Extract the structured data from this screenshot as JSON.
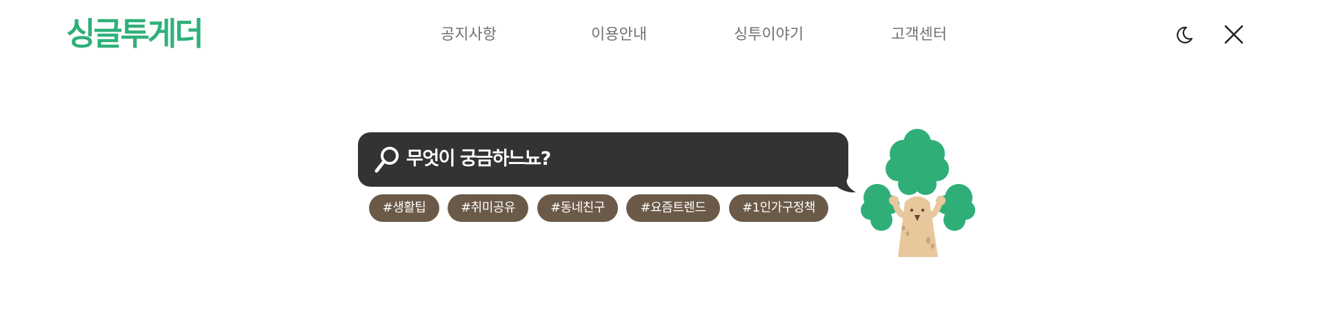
{
  "header": {
    "logo": "싱글투게더",
    "nav": [
      "공지사항",
      "이용안내",
      "싱투이야기",
      "고객센터"
    ],
    "icons": {
      "theme_toggle": "moon-icon",
      "close": "close-icon"
    }
  },
  "search": {
    "prompt": "무엇이 궁금하느뇨?",
    "icon": "search-icon",
    "tags": [
      "#생활팁",
      "#취미공유",
      "#동네친구",
      "#요즘트렌드",
      "#1인가구정책"
    ]
  },
  "colors": {
    "brand": "#2fb07a",
    "bubble": "#333333",
    "tag": "#6b5a48",
    "nav_text": "#707070"
  },
  "mascot": "tree-mascot"
}
